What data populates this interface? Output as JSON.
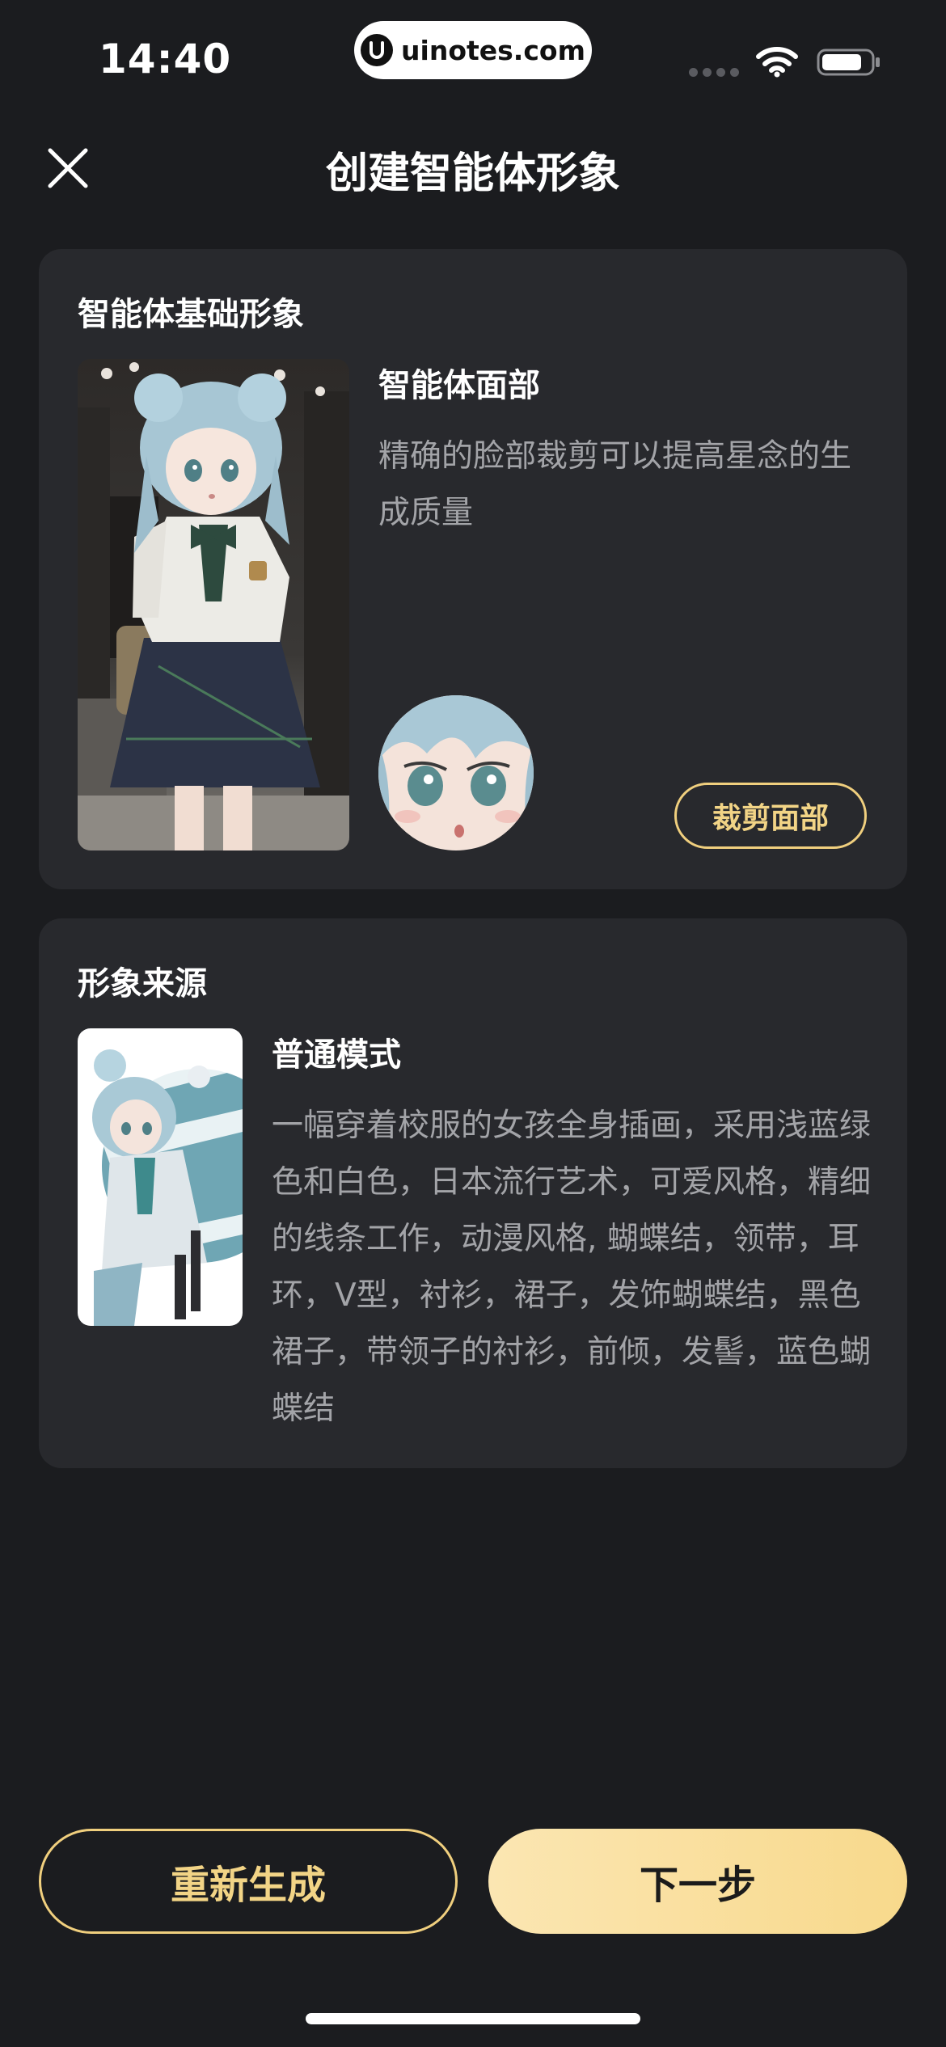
{
  "status_bar": {
    "time": "14:40",
    "watermark": "uinotes.com"
  },
  "header": {
    "title": "创建智能体形象",
    "close_icon": "close-icon"
  },
  "basic_card": {
    "heading": "智能体基础形象",
    "face_title": "智能体面部",
    "face_description": "精确的脸部裁剪可以提高星念的生成质量",
    "crop_button": "裁剪面部"
  },
  "source_card": {
    "heading": "形象来源",
    "mode_title": "普通模式",
    "mode_description": "一幅穿着校服的女孩全身插画，采用浅蓝绿色和白色，日本流行艺术，可爱风格，精细的线条工作，动漫风格, 蝴蝶结，领带，耳环，V型，衬衫，裙子，发饰蝴蝶结，黑色裙子，带领子的衬衫，前倾，发髻，蓝色蝴蝶结"
  },
  "footer": {
    "regenerate_label": "重新生成",
    "next_label": "下一步"
  },
  "colors": {
    "background": "#1b1c1f",
    "card": "#28292d",
    "accent_gold": "#f2d486",
    "muted_text": "#a3a4a8"
  }
}
